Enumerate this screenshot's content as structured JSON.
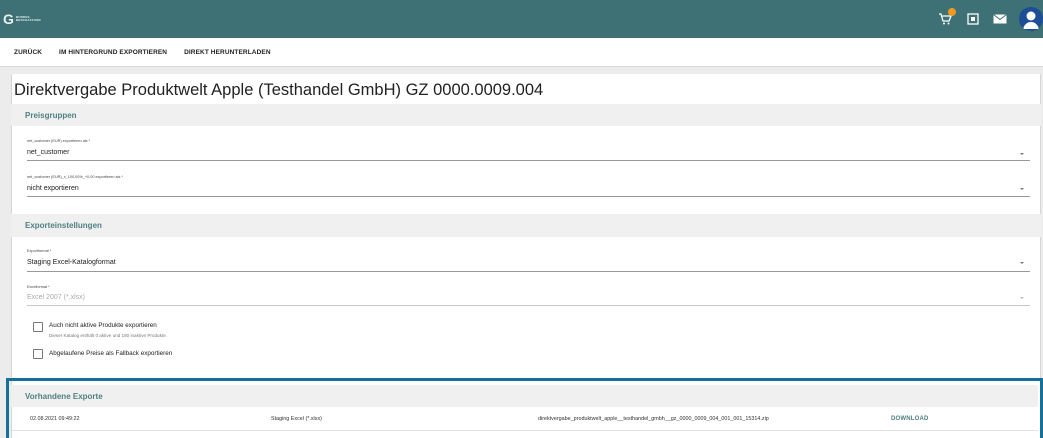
{
  "header": {
    "logo_letter": "G",
    "logo_text_line1": "BUNDES",
    "logo_text_line2": "BESCHAFFUNG",
    "icons": [
      "cart-icon",
      "download-box-icon",
      "mail-icon",
      "user-avatar-icon"
    ],
    "accent_color": "#3d7176",
    "badge_color": "#f29a1f"
  },
  "actions": {
    "back": "ZURÜCK",
    "export_background": "IM HINTERGRUND EXPORTIEREN",
    "direct_download": "DIREKT HERUNTERLADEN"
  },
  "page": {
    "title": "Direktvergabe Produktwelt Apple (Testhandel GmbH) GZ 0000.0009.004"
  },
  "price_groups": {
    "heading": "Preisgruppen",
    "field1": {
      "label": "net_customer (EUR) exportieren als *",
      "value": "net_customer"
    },
    "field2": {
      "label": "net_customer (EUR)_x_100,00%_+0,00 exportieren als *",
      "value": "nicht exportieren"
    }
  },
  "export_settings": {
    "heading": "Exporteinstellungen",
    "format": {
      "label": "Exportformat *",
      "value": "Staging Excel-Katalogformat"
    },
    "excel_format": {
      "label": "Excelformat *",
      "value": "Excel 2007 (*.xlsx)"
    },
    "checkbox_inactive": {
      "label": "Auch nicht aktive Produkte exportieren",
      "sublabel": "Dieser Katalog enthält 0 aktive und 180 inaktive Produkte.",
      "checked": false
    },
    "checkbox_expired": {
      "label": "Abgelaufene Preise als Fallback exportieren",
      "checked": false
    }
  },
  "existing_exports": {
    "heading": "Vorhandene Exporte",
    "rows": [
      {
        "date": "02.08.2021 09:49:22",
        "format": "Staging Excel (*.xlsx)",
        "filename": "direktvergabe_produktwelt_apple__testhandel_gmbh__gz_0000_0009_004_001_001_15314.zip",
        "action": "DOWNLOAD"
      }
    ],
    "highlight_color": "#15709a"
  }
}
